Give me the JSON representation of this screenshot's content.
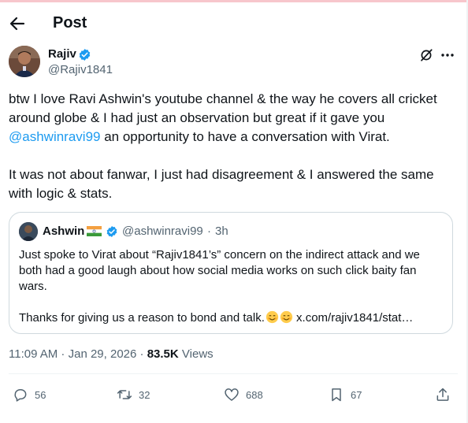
{
  "header": {
    "title": "Post"
  },
  "author": {
    "name": "Rajiv",
    "handle": "@Rajiv1841"
  },
  "tweet": {
    "line1": "btw I love Ravi Ashwin's youtube channel & the way he covers all cricket around globe & I had just an observation but great if it gave you",
    "mention": "@ashwinravi99",
    "line1_tail": " an opportunity to have a conversation with Virat.",
    "paragraph2": "It was not about fanwar, I just had disagreement & I answered the same with logic & stats."
  },
  "quote": {
    "name": "Ashwin",
    "handle": "@ashwinravi99",
    "dot": "·",
    "time": "3h",
    "paragraph1": "Just spoke to Virat about “Rajiv1841’s” concern on the indirect attack and we both had a good laugh about how social media works on such click baity fan wars.",
    "paragraph2": "Thanks for giving us a reason to bond and talk.",
    "link": "x.com/rajiv1841/stat…"
  },
  "meta": {
    "time": "11:09 AM",
    "separator": " · ",
    "date": "Jan 29, 2026",
    "views_count": "83.5K",
    "views_label": "Views"
  },
  "actions": {
    "replies": "56",
    "reposts": "32",
    "likes": "688",
    "bookmarks": "67"
  },
  "colors": {
    "accent": "#1d9bf0",
    "secondary_text": "#536471",
    "border": "#cfd9de"
  }
}
